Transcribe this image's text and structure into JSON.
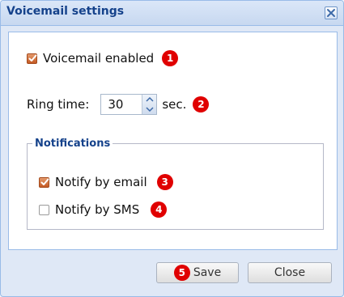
{
  "dialog": {
    "title": "Voicemail settings",
    "close_icon": "close-x-icon"
  },
  "voicemail": {
    "label": "Voicemail enabled",
    "checked": true,
    "badge": "1"
  },
  "ring_time": {
    "label": "Ring time:",
    "value": "30",
    "unit": "sec.",
    "badge": "2"
  },
  "notifications": {
    "legend": "Notifications",
    "email": {
      "label": "Notify by email",
      "checked": true,
      "badge": "3"
    },
    "sms": {
      "label": "Notify by SMS",
      "checked": false,
      "badge": "4"
    }
  },
  "buttons": {
    "save_badge": "5",
    "save_label": "Save",
    "close_label": "Close"
  },
  "colors": {
    "badge": "#e00000",
    "checkbox_checked": "#d0683a",
    "title_text": "#15428b"
  }
}
